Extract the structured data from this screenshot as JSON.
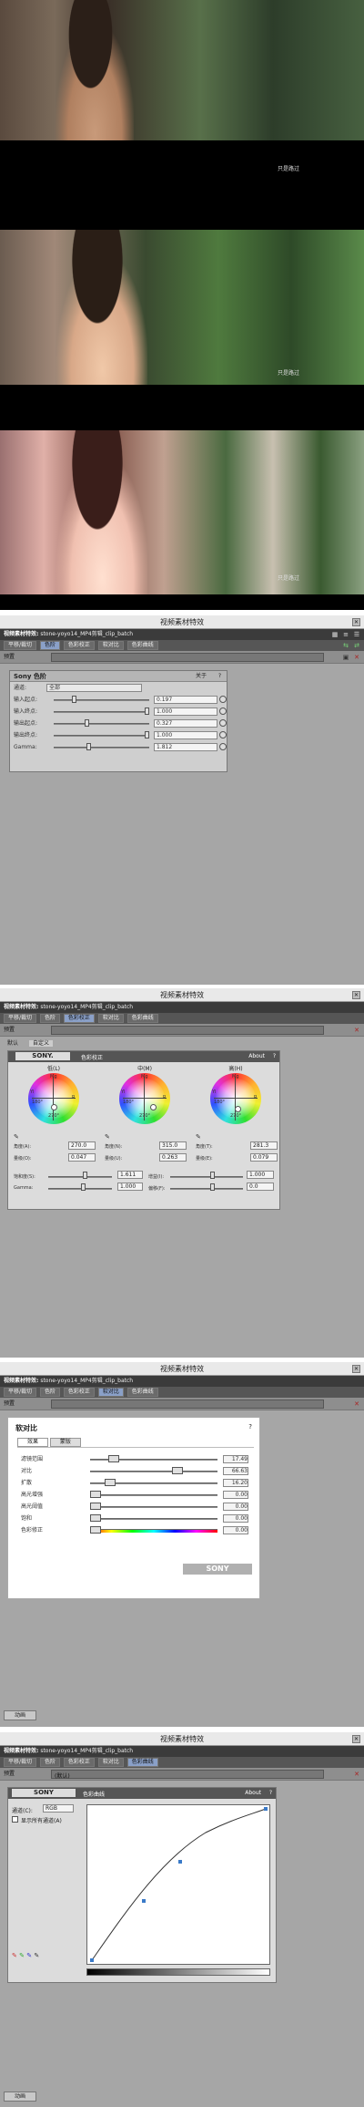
{
  "frames": [
    {
      "subtitle": "只是路过"
    },
    {
      "subtitle": "只是路过"
    },
    {
      "subtitle": "只是路过"
    }
  ],
  "window_title": "视频素材特效",
  "header": {
    "label": "视频素材特效:",
    "clip": "stone-yoyo14_MP4剪辑_clip_batch"
  },
  "tabs": [
    "平移/裁切",
    "色阶",
    "色彩校正",
    "软对比",
    "色彩曲线"
  ],
  "preset_label": "预置",
  "panel1": {
    "title": "Sony 色阶",
    "about": "关于",
    "help": "?",
    "channel_label": "通道:",
    "channel_value": "全部",
    "rows": [
      {
        "label": "输入起点:",
        "value": "0.197"
      },
      {
        "label": "输入终点:",
        "value": "1.000"
      },
      {
        "label": "输出起点:",
        "value": "0.327"
      },
      {
        "label": "输出终点:",
        "value": "1.000"
      },
      {
        "label": "Gamma:",
        "value": "1.812"
      }
    ]
  },
  "panel2": {
    "tab_default": "默认",
    "tab_custom": "自定义",
    "brand": "SONY.",
    "title": "色彩校正",
    "about": "About",
    "help": "?",
    "wheel_titles": [
      "低(L)",
      "中(M)",
      "高(H)"
    ],
    "wheel_labels": {
      "top": "Mg",
      "right": "R",
      "left": "Yl",
      "bottom": "B",
      "deg90": "90°",
      "deg180": "180°",
      "deg0": "0°",
      "deg270": "270°",
      "g": "G",
      "cy": "Cy"
    },
    "angles": [
      {
        "label": "角度(A):",
        "value": "270.0"
      },
      {
        "label": "角度(N):",
        "value": "315.0"
      },
      {
        "label": "角度(T):",
        "value": "281.3"
      }
    ],
    "amounts": [
      {
        "label": "量级(O):",
        "value": "0.047"
      },
      {
        "label": "量级(U):",
        "value": "0.263"
      },
      {
        "label": "量级(E):",
        "value": "0.079"
      }
    ],
    "sat_label": "饱和度(S):",
    "sat_value": "1.611",
    "gain_label": "增益(I):",
    "gain_value": "1.000",
    "gamma_label": "Gamma:",
    "gamma_value": "1.000",
    "offset_label": "偏移(F):",
    "offset_value": "0.0"
  },
  "panel3": {
    "title": "软对比",
    "help": "?",
    "tab_a": "效果",
    "tab_b": "蒙版",
    "rows": [
      {
        "label": "滤镜范围",
        "value": "17.49"
      },
      {
        "label": "对比",
        "value": "66.63"
      },
      {
        "label": "扩散",
        "value": "16.20"
      },
      {
        "label": "高光增强",
        "value": "0.00"
      },
      {
        "label": "高光阈值",
        "value": "0.00"
      },
      {
        "label": "饱和",
        "value": "0.00"
      },
      {
        "label": "色彩修正",
        "value": "0.00"
      }
    ],
    "brand": "SONY",
    "anim": "动画"
  },
  "panel4": {
    "brand": "SONY",
    "title": "色彩曲线",
    "about": "About",
    "help": "?",
    "preset_value": "(默认)",
    "channel_label": "通道(C):",
    "channel_value": "RGB",
    "show_all": "显示所有通道(A)",
    "anim": "动画"
  }
}
